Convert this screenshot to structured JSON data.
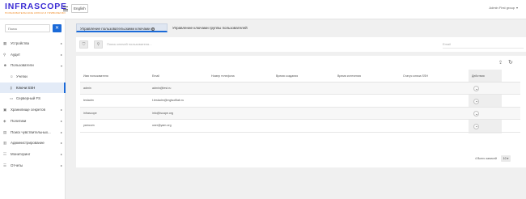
{
  "header": {
    "logo_title": "INFRASCOPE",
    "logo_subtitle": "ПОЛЬЗОВАТЕЛЬСКИЕ КЛЮЧИ И ПРИВИЛЕГИИ",
    "language": "English",
    "user": "Admin First group"
  },
  "sidebar": {
    "search_placeholder": "Поиск",
    "clear_label": "✕",
    "items": [
      {
        "label": "Устройства",
        "icon": "server-icon",
        "expandable": true
      },
      {
        "label": "Аудит",
        "icon": "audit-icon",
        "expandable": true
      },
      {
        "label": "Пользователи",
        "icon": "users-icon",
        "expanded": true
      },
      {
        "label": "Учетки",
        "icon": "user-icon",
        "sub": true
      },
      {
        "label": "Ключи SSH",
        "icon": "key-icon",
        "sub": true,
        "active": true
      },
      {
        "label": "Серверный FS",
        "icon": "folder-icon",
        "sub": true
      },
      {
        "label": "Хранилище секретов",
        "icon": "vault-icon",
        "expandable": true
      },
      {
        "label": "Политики",
        "icon": "policy-icon",
        "expandable": true
      },
      {
        "label": "Поиск чувствительных...",
        "icon": "search-doc-icon",
        "expandable": true
      },
      {
        "label": "Администрирование",
        "icon": "admin-icon",
        "expandable": true
      },
      {
        "label": "Мониторинг",
        "icon": "monitor-icon",
        "expandable": true
      },
      {
        "label": "Отчеты",
        "icon": "report-icon",
        "expandable": true
      }
    ]
  },
  "tabs": {
    "active": "Управление пользовательскими ключами",
    "inactive": "Управление ключами группы пользователей"
  },
  "filter": {
    "search_placeholder": "Поиск ключей пользователя...",
    "email_placeholder": "Email"
  },
  "table": {
    "columns": [
      "Имя пользователя",
      "Email",
      "Номер телефона",
      "Время создания",
      "Время истечения",
      "Статус ключа SSH",
      "Действия"
    ],
    "rows": [
      {
        "username": "admin",
        "email": "admin@test.ru"
      },
      {
        "username": "testadm",
        "email": "t.testadm@mgtsoftlab.ru"
      },
      {
        "username": "infrascope",
        "email": "info@iscape.org"
      },
      {
        "username": "yamcom",
        "email": "user@yam.org"
      }
    ]
  },
  "pagination": {
    "summary": "4 Всего записей",
    "page_size": "10 ▾"
  },
  "colors": {
    "brand": "#3a2bd4",
    "accent": "#1b6ad8",
    "logo_sub": "#f08a24"
  }
}
